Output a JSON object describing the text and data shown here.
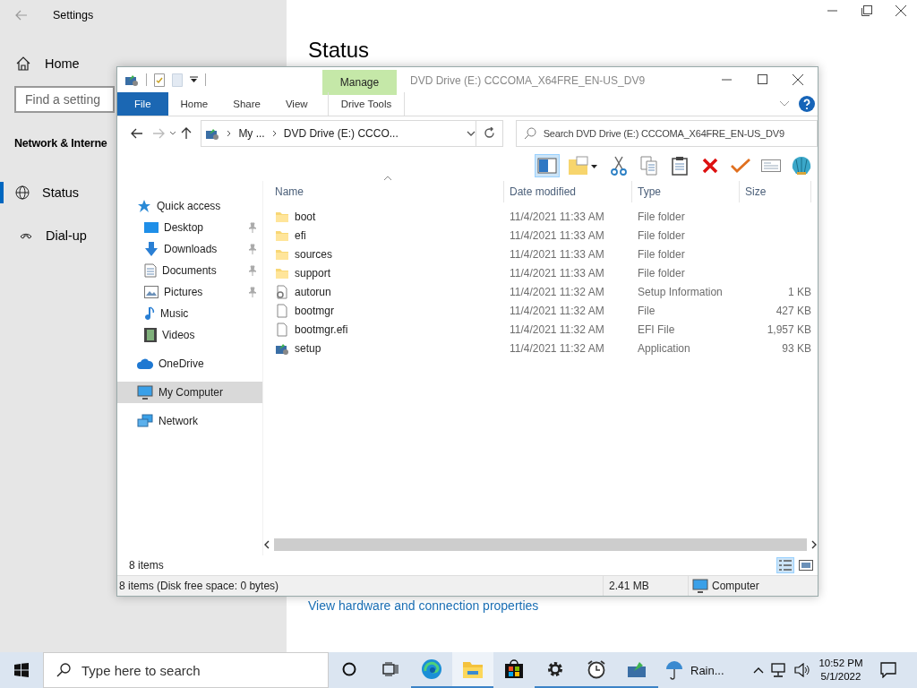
{
  "settings": {
    "title": "Settings",
    "home": "Home",
    "search": {
      "placeholder": "Find a setting"
    },
    "section": "Network & Interne",
    "nav": [
      {
        "label": "Status",
        "kind": "globe",
        "selected": true
      },
      {
        "label": "Dial-up",
        "kind": "phone",
        "selected": false
      }
    ],
    "heading": "Status",
    "link": "View hardware and connection properties"
  },
  "explorer": {
    "contextual_tab": "Manage",
    "title": "DVD Drive (E:) CCCOMA_X64FRE_EN-US_DV9",
    "tabs": [
      {
        "label": "File",
        "kind": "file"
      },
      {
        "label": "Home",
        "kind": "plain"
      },
      {
        "label": "Share",
        "kind": "plain"
      },
      {
        "label": "View",
        "kind": "plain"
      },
      {
        "label": "Drive Tools",
        "kind": "contextual"
      }
    ],
    "breadcrumb": [
      "My ...",
      "DVD Drive (E:) CCCO..."
    ],
    "search": {
      "placeholder": "Search DVD Drive (E:) CCCOMA_X64FRE_EN-US_DV9"
    },
    "toolbar": [
      {
        "kind": "pane",
        "selected": true
      },
      {
        "kind": "folder-menu",
        "selected": false
      },
      {
        "kind": "cut",
        "selected": false
      },
      {
        "kind": "copy",
        "selected": false
      },
      {
        "kind": "paste",
        "selected": false
      },
      {
        "kind": "delete",
        "selected": false
      },
      {
        "kind": "check",
        "selected": false
      },
      {
        "kind": "mail",
        "selected": false
      },
      {
        "kind": "shell",
        "selected": false
      }
    ],
    "nav": [
      {
        "label": "Quick access",
        "kind": "star",
        "selected": false,
        "children": [
          {
            "label": "Desktop",
            "kind": "desktop",
            "pinned": true,
            "selected": false
          },
          {
            "label": "Downloads",
            "kind": "download",
            "pinned": true,
            "selected": false
          },
          {
            "label": "Documents",
            "kind": "document",
            "pinned": true,
            "selected": false
          },
          {
            "label": "Pictures",
            "kind": "pictures",
            "pinned": true,
            "selected": false
          },
          {
            "label": "Music",
            "kind": "music",
            "pinned": false,
            "selected": false
          },
          {
            "label": "Videos",
            "kind": "video",
            "pinned": false,
            "selected": false
          }
        ]
      },
      {
        "label": "OneDrive",
        "kind": "cloud",
        "selected": false
      },
      {
        "label": "My Computer",
        "kind": "computer",
        "selected": true
      },
      {
        "label": "Network",
        "kind": "network",
        "selected": false
      }
    ],
    "columns": [
      "Name",
      "Date modified",
      "Type",
      "Size"
    ],
    "rows": [
      {
        "name": "boot",
        "kind": "folder",
        "date": "11/4/2021 11:33 AM",
        "type": "File folder"
      },
      {
        "name": "efi",
        "kind": "folder",
        "date": "11/4/2021 11:33 AM",
        "type": "File folder"
      },
      {
        "name": "sources",
        "kind": "folder",
        "date": "11/4/2021 11:33 AM",
        "type": "File folder"
      },
      {
        "name": "support",
        "kind": "folder",
        "date": "11/4/2021 11:33 AM",
        "type": "File folder"
      },
      {
        "name": "autorun",
        "kind": "settings-file",
        "date": "11/4/2021 11:32 AM",
        "type": "Setup Information",
        "size": "1 KB"
      },
      {
        "name": "bootmgr",
        "kind": "file",
        "date": "11/4/2021 11:32 AM",
        "type": "File",
        "size": "427 KB"
      },
      {
        "name": "bootmgr.efi",
        "kind": "file",
        "date": "11/4/2021 11:32 AM",
        "type": "EFI File",
        "size": "1,957 KB"
      },
      {
        "name": "setup",
        "kind": "app",
        "date": "11/4/2021 11:32 AM",
        "type": "Application",
        "size": "93 KB"
      }
    ],
    "item_count": "8 items",
    "views": [
      {
        "kind": "details",
        "selected": true
      },
      {
        "kind": "large",
        "selected": false
      }
    ],
    "status": {
      "text": "8 items (Disk free space: 0 bytes)",
      "size": "2.41 MB",
      "location": "Computer"
    }
  },
  "taskbar": {
    "search": {
      "placeholder": "Type here to search"
    },
    "apps": [
      {
        "kind": "edge",
        "running": true,
        "selected": false
      },
      {
        "kind": "explorer",
        "running": true,
        "selected": true
      },
      {
        "kind": "store",
        "running": false,
        "selected": false
      },
      {
        "kind": "gear",
        "running": true,
        "selected": false
      },
      {
        "kind": "alarm",
        "running": true,
        "selected": false
      },
      {
        "kind": "setup",
        "running": true,
        "selected": false
      }
    ],
    "weather": "Rain...",
    "time": "10:52 PM",
    "date": "5/1/2022"
  }
}
